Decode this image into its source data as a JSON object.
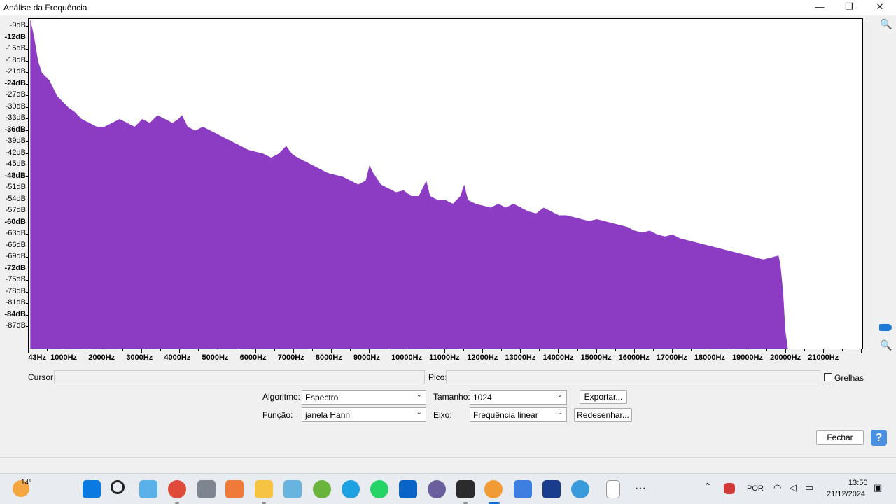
{
  "window": {
    "title": "Análise da Frequência",
    "minimize_icon": "minimize-icon",
    "restore_icon": "restore-icon",
    "close_icon": "close-icon"
  },
  "chart_data": {
    "type": "area",
    "color": "#8b3cc2",
    "xlim": [
      0,
      22050
    ],
    "ylim": [
      -93,
      -7
    ],
    "ylabel_ticks": [
      {
        "label": "-9dB",
        "v": -9,
        "bold": false
      },
      {
        "label": "-12dB",
        "v": -12,
        "bold": true
      },
      {
        "label": "-15dB",
        "v": -15,
        "bold": false
      },
      {
        "label": "-18dB",
        "v": -18,
        "bold": false
      },
      {
        "label": "-21dB",
        "v": -21,
        "bold": false
      },
      {
        "label": "-24dB",
        "v": -24,
        "bold": true
      },
      {
        "label": "-27dB",
        "v": -27,
        "bold": false
      },
      {
        "label": "-30dB",
        "v": -30,
        "bold": false
      },
      {
        "label": "-33dB",
        "v": -33,
        "bold": false
      },
      {
        "label": "-36dB",
        "v": -36,
        "bold": true
      },
      {
        "label": "-39dB",
        "v": -39,
        "bold": false
      },
      {
        "label": "-42dB",
        "v": -42,
        "bold": false
      },
      {
        "label": "-45dB",
        "v": -45,
        "bold": false
      },
      {
        "label": "-48dB",
        "v": -48,
        "bold": true
      },
      {
        "label": "-51dB",
        "v": -51,
        "bold": false
      },
      {
        "label": "-54dB",
        "v": -54,
        "bold": false
      },
      {
        "label": "-57dB",
        "v": -57,
        "bold": false
      },
      {
        "label": "-60dB",
        "v": -60,
        "bold": true
      },
      {
        "label": "-63dB",
        "v": -63,
        "bold": false
      },
      {
        "label": "-66dB",
        "v": -66,
        "bold": false
      },
      {
        "label": "-69dB",
        "v": -69,
        "bold": false
      },
      {
        "label": "-72dB",
        "v": -72,
        "bold": true
      },
      {
        "label": "-75dB",
        "v": -75,
        "bold": false
      },
      {
        "label": "-78dB",
        "v": -78,
        "bold": false
      },
      {
        "label": "-81dB",
        "v": -81,
        "bold": false
      },
      {
        "label": "-84dB",
        "v": -84,
        "bold": true
      },
      {
        "label": "-87dB",
        "v": -87,
        "bold": false
      }
    ],
    "xlabel_ticks": [
      {
        "label": "43Hz",
        "v": 43
      },
      {
        "label": "1000Hz",
        "v": 1000
      },
      {
        "label": "2000Hz",
        "v": 2000
      },
      {
        "label": "3000Hz",
        "v": 3000
      },
      {
        "label": "4000Hz",
        "v": 4000
      },
      {
        "label": "5000Hz",
        "v": 5000
      },
      {
        "label": "6000Hz",
        "v": 6000
      },
      {
        "label": "7000Hz",
        "v": 7000
      },
      {
        "label": "8000Hz",
        "v": 8000
      },
      {
        "label": "9000Hz",
        "v": 9000
      },
      {
        "label": "10000Hz",
        "v": 10000
      },
      {
        "label": "11000Hz",
        "v": 11000
      },
      {
        "label": "12000Hz",
        "v": 12000
      },
      {
        "label": "13000Hz",
        "v": 13000
      },
      {
        "label": "14000Hz",
        "v": 14000
      },
      {
        "label": "15000Hz",
        "v": 15000
      },
      {
        "label": "16000Hz",
        "v": 16000
      },
      {
        "label": "17000Hz",
        "v": 17000
      },
      {
        "label": "18000Hz",
        "v": 18000
      },
      {
        "label": "19000Hz",
        "v": 19000
      },
      {
        "label": "20000Hz",
        "v": 20000
      },
      {
        "label": "21000Hz",
        "v": 21000
      }
    ],
    "points": [
      [
        43,
        -7
      ],
      [
        150,
        -12
      ],
      [
        250,
        -18
      ],
      [
        350,
        -21
      ],
      [
        450,
        -22
      ],
      [
        550,
        -23
      ],
      [
        650,
        -25
      ],
      [
        750,
        -27
      ],
      [
        850,
        -28
      ],
      [
        950,
        -29
      ],
      [
        1050,
        -30
      ],
      [
        1200,
        -31
      ],
      [
        1400,
        -33
      ],
      [
        1600,
        -34
      ],
      [
        1800,
        -35
      ],
      [
        2000,
        -35
      ],
      [
        2200,
        -34
      ],
      [
        2400,
        -33
      ],
      [
        2600,
        -34
      ],
      [
        2800,
        -35
      ],
      [
        3000,
        -33
      ],
      [
        3200,
        -34
      ],
      [
        3400,
        -32
      ],
      [
        3600,
        -33
      ],
      [
        3800,
        -34
      ],
      [
        3950,
        -33
      ],
      [
        4050,
        -32
      ],
      [
        4200,
        -35
      ],
      [
        4400,
        -36
      ],
      [
        4600,
        -35
      ],
      [
        4800,
        -36
      ],
      [
        5000,
        -37
      ],
      [
        5200,
        -38
      ],
      [
        5400,
        -39
      ],
      [
        5600,
        -40
      ],
      [
        5800,
        -41
      ],
      [
        6000,
        -41.5
      ],
      [
        6200,
        -42
      ],
      [
        6400,
        -43
      ],
      [
        6600,
        -42
      ],
      [
        6800,
        -40
      ],
      [
        6950,
        -42
      ],
      [
        7100,
        -43
      ],
      [
        7300,
        -44
      ],
      [
        7500,
        -45
      ],
      [
        7700,
        -46
      ],
      [
        7900,
        -47
      ],
      [
        8100,
        -47.5
      ],
      [
        8300,
        -48
      ],
      [
        8500,
        -49
      ],
      [
        8700,
        -50
      ],
      [
        8900,
        -49
      ],
      [
        9000,
        -45
      ],
      [
        9100,
        -47
      ],
      [
        9300,
        -50
      ],
      [
        9500,
        -51
      ],
      [
        9700,
        -52
      ],
      [
        9900,
        -51.5
      ],
      [
        10100,
        -53
      ],
      [
        10300,
        -53
      ],
      [
        10500,
        -49
      ],
      [
        10600,
        -53
      ],
      [
        10800,
        -54
      ],
      [
        11000,
        -54
      ],
      [
        11200,
        -55
      ],
      [
        11400,
        -53
      ],
      [
        11500,
        -50
      ],
      [
        11600,
        -54
      ],
      [
        11800,
        -55
      ],
      [
        12000,
        -55.5
      ],
      [
        12200,
        -56
      ],
      [
        12400,
        -55
      ],
      [
        12600,
        -56
      ],
      [
        12800,
        -55
      ],
      [
        13000,
        -56
      ],
      [
        13200,
        -57
      ],
      [
        13400,
        -57.5
      ],
      [
        13600,
        -56
      ],
      [
        13800,
        -57
      ],
      [
        14000,
        -58
      ],
      [
        14200,
        -58
      ],
      [
        14400,
        -58.5
      ],
      [
        14600,
        -59
      ],
      [
        14800,
        -59.5
      ],
      [
        15000,
        -59
      ],
      [
        15200,
        -59.5
      ],
      [
        15400,
        -60
      ],
      [
        15600,
        -60.5
      ],
      [
        15800,
        -61
      ],
      [
        16000,
        -62
      ],
      [
        16200,
        -62.5
      ],
      [
        16400,
        -62
      ],
      [
        16600,
        -63
      ],
      [
        16800,
        -63.5
      ],
      [
        17000,
        -63
      ],
      [
        17200,
        -64
      ],
      [
        17400,
        -64.5
      ],
      [
        17600,
        -65
      ],
      [
        17800,
        -65.5
      ],
      [
        18000,
        -66
      ],
      [
        18200,
        -66.5
      ],
      [
        18400,
        -67
      ],
      [
        18600,
        -67.5
      ],
      [
        18800,
        -68
      ],
      [
        19000,
        -68.5
      ],
      [
        19200,
        -69
      ],
      [
        19400,
        -69.5
      ],
      [
        19600,
        -69
      ],
      [
        19800,
        -68.5
      ],
      [
        19850,
        -71
      ],
      [
        19920,
        -78
      ],
      [
        19980,
        -88
      ],
      [
        20050,
        -93
      ]
    ]
  },
  "controls": {
    "cursor_label": "Cursor:",
    "cursor_value": "",
    "peak_label": "Pico:",
    "peak_value": "",
    "grid_label": "Grelhas",
    "algorithm_label": "Algoritmo:",
    "algorithm_value": "Espectro",
    "size_label": "Tamanho:",
    "size_value": "1024",
    "export_label": "Exportar...",
    "function_label": "Função:",
    "function_value": "janela Hann",
    "axis_label": "Eixo:",
    "axis_value": "Frequência linear",
    "redraw_label": "Redesenhar...",
    "close_label": "Fechar",
    "help_label": "?"
  },
  "taskbar": {
    "weather_temp": "14°",
    "language": "POR",
    "time": "13:50",
    "date": "21/12/2024",
    "more_label": "···"
  }
}
